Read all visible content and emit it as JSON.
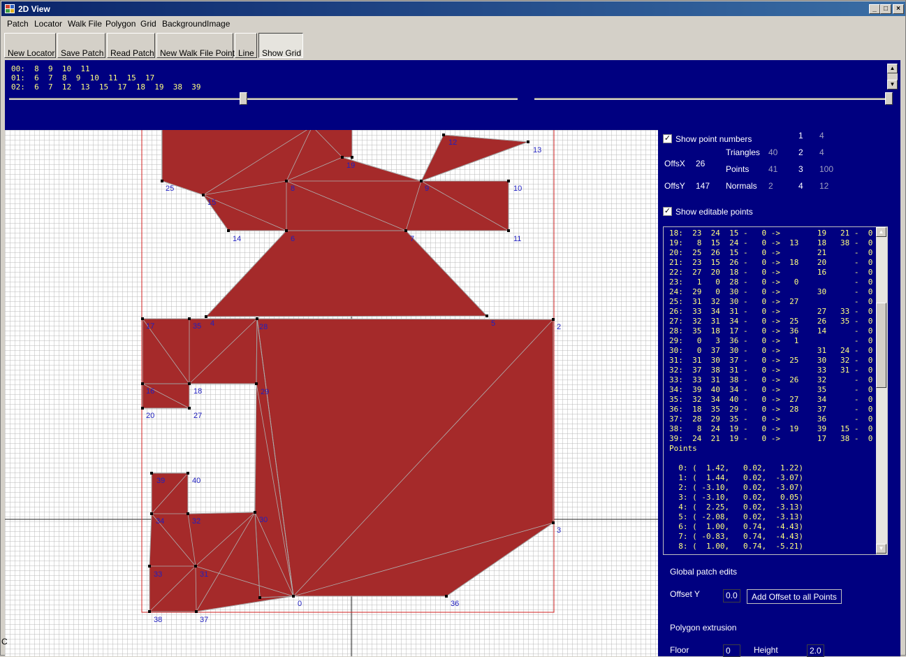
{
  "window": {
    "title": "2D View"
  },
  "menu": [
    "Patch",
    "Locator",
    "Walk File",
    "Polygon",
    "Grid",
    "BackgroundImage"
  ],
  "toolbar": [
    "New Locator",
    "Save Patch",
    "Read Patch",
    "New Walk File Point",
    "Line",
    "Show Grid"
  ],
  "top_lines": [
    "00:  8  9  10  11",
    "01:  6  7  8  9  10  11  15  17",
    "02:  6  7  12  13  15  17  18  19  38  39"
  ],
  "sliders": {
    "left_fraction": 0.46,
    "right_fraction": 0.99
  },
  "colors": {
    "panel": "#000080",
    "polygon": "#a52a2a",
    "highlight_text": "#ffff80",
    "point_label": "#2020c0",
    "bounds": "#d02020"
  },
  "right": {
    "show_point_numbers": "Show point numbers",
    "offsx_label": "OffsX",
    "offsx": "26",
    "offsy_label": "OffsY",
    "offsy": "147",
    "triangles_label": "Triangles",
    "triangles": "40",
    "points_label": "Points",
    "points": "41",
    "normals_label": "Normals",
    "normals": "2",
    "col_a": [
      "1",
      "2",
      "3",
      "4"
    ],
    "col_b": [
      "4",
      "4",
      "100",
      "12"
    ],
    "show_editable_points": "Show editable points",
    "global_edits": "Global patch edits",
    "offset_y_label": "Offset Y",
    "offset_y": "0.0",
    "add_offset": "Add Offset to all Points",
    "polygon_extrusion": "Polygon extrusion",
    "floor_label": "Floor",
    "floor": "0",
    "height_label": "Height",
    "height": "2.0"
  },
  "list_lines": [
    "18:  23  24  15 -   0 ->        19   21 -  0",
    "19:   8  15  24 -   0 ->  13    18   38 -  0",
    "20:  25  26  15 -   0 ->        21      -  0",
    "21:  23  15  26 -   0 ->  18    20      -  0",
    "22:  27  20  18 -   0 ->        16      -  0",
    "23:   1   0  28 -   0 ->   0            -  0",
    "24:  29   0  30 -   0 ->        30      -  0",
    "25:  31  32  30 -   0 ->  27            -  0",
    "26:  33  34  31 -   0 ->        27   33 -  0",
    "27:  32  31  34 -   0 ->  25    26   35 -  0",
    "28:  35  18  17 -   0 ->  36    14      -  0",
    "29:   0   3  36 -   0 ->   1            -  0",
    "30:   0  37  30 -   0 ->        31   24 -  0",
    "31:  31  30  37 -   0 ->  25    30   32 -  0",
    "32:  37  38  31 -   0 ->        33   31 -  0",
    "33:  33  31  38 -   0 ->  26    32      -  0",
    "34:  39  40  34 -   0 ->        35      -  0",
    "35:  32  34  40 -   0 ->  27    34      -  0",
    "36:  18  35  29 -   0 ->  28    37      -  0",
    "37:  28  29  35 -   0 ->        36      -  0",
    "38:   8  24  19 -   0 ->  19    39   15 -  0",
    "39:  24  21  19 -   0 ->        17   38 -  0",
    "Points",
    "",
    "  0: (  1.42,   0.02,   1.22)",
    "  1: (  1.44,   0.02,  -3.07)",
    "  2: ( -3.10,   0.02,  -3.07)",
    "  3: ( -3.10,   0.02,   0.05)",
    "  4: (  2.25,   0.02,  -3.13)",
    "  5: ( -2.08,   0.02,  -3.13)",
    "  6: (  1.00,   0.74,  -4.43)",
    "  7: ( -0.83,   0.74,  -4.43)",
    "  8: (  1.00,   0.74,  -5.21)"
  ],
  "point_labels": [
    "0",
    "2",
    "3",
    "4",
    "5",
    "6",
    "7",
    "8",
    "9",
    "10",
    "11",
    "12",
    "13",
    "14",
    "15",
    "16",
    "17",
    "18",
    "19",
    "20",
    "25",
    "27",
    "28",
    "29",
    "30",
    "31",
    "32",
    "33",
    "34",
    "35",
    "36",
    "37",
    "38",
    "39",
    "40"
  ],
  "left_edge_char": "C"
}
